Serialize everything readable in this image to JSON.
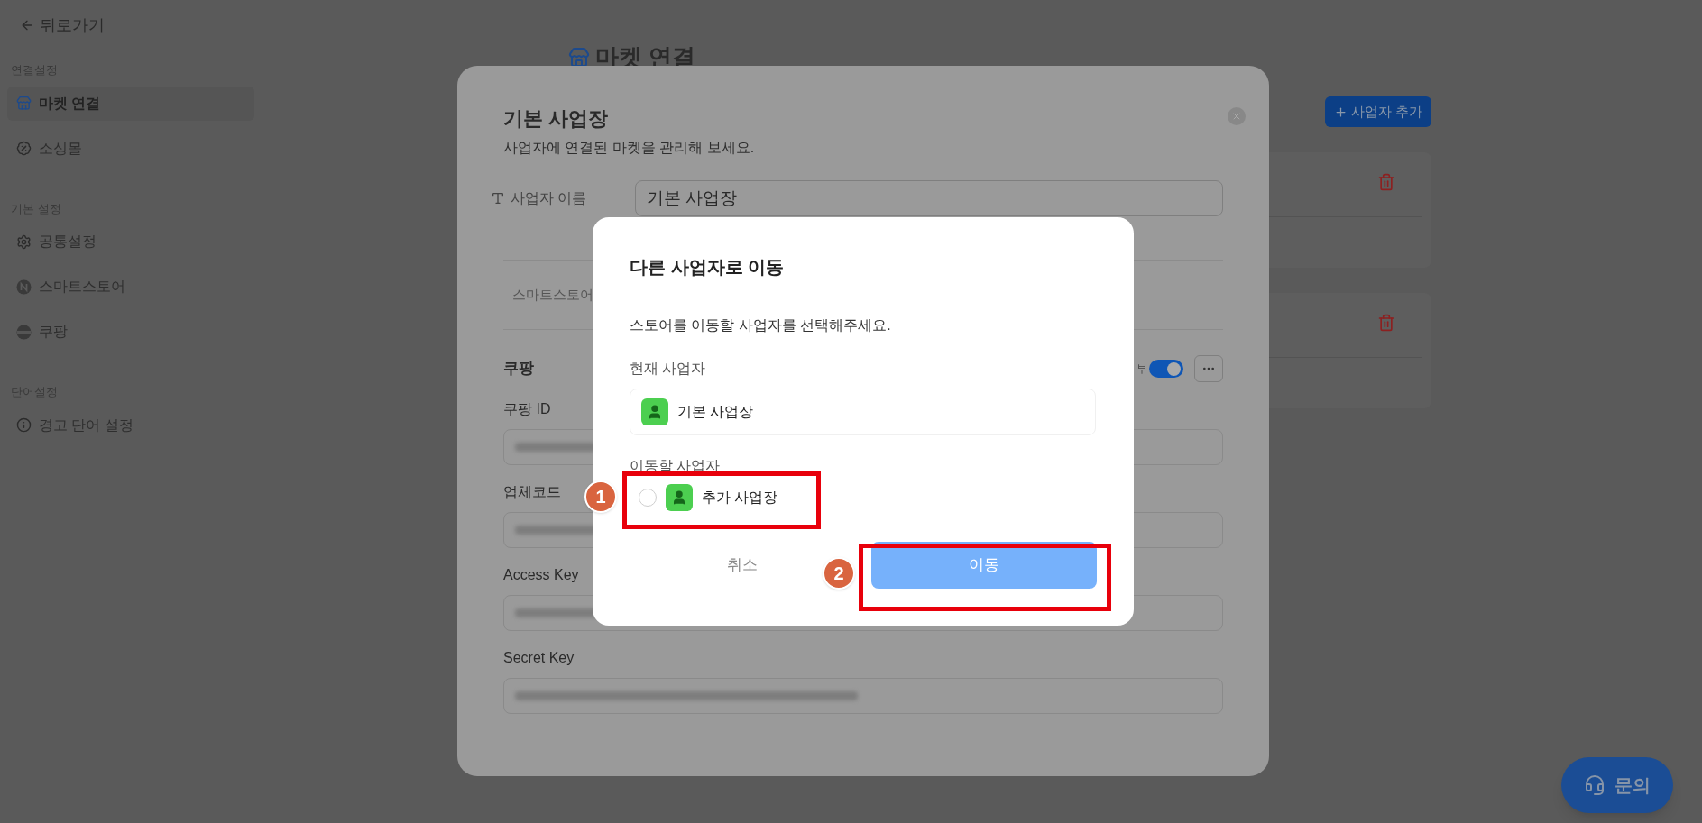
{
  "back_link": "뒤로가기",
  "sidebar": {
    "sections": [
      {
        "label": "연결설정",
        "items": [
          {
            "label": "마켓 연결",
            "selected": true
          },
          {
            "label": "소싱몰",
            "selected": false
          }
        ]
      },
      {
        "label": "기본 설정",
        "items": [
          {
            "label": "공통설정",
            "selected": false
          },
          {
            "label": "스마트스토어",
            "selected": false
          },
          {
            "label": "쿠팡",
            "selected": false
          }
        ]
      },
      {
        "label": "단어설정",
        "items": [
          {
            "label": "경고 단어 설정",
            "selected": false
          }
        ]
      }
    ]
  },
  "page": {
    "title": "마켓 연결",
    "add_button": "사업자 추가"
  },
  "modal": {
    "title": "기본 사업장",
    "subtitle": "사업자에 연결된 마켓을 관리해 보세요.",
    "name_field": {
      "label": "사업자 이름",
      "value": "기본 사업장"
    },
    "tab_label": "스마트스토어",
    "market": {
      "name": "쿠팡",
      "toggle_label": "부",
      "enabled": true,
      "fields": [
        {
          "label": "쿠팡 ID"
        },
        {
          "label": "업체코드"
        },
        {
          "label": "Access Key"
        },
        {
          "label": "Secret Key"
        }
      ]
    }
  },
  "dialog": {
    "title": "다른 사업자로 이동",
    "description": "스토어를 이동할 사업자를 선택해주세요.",
    "current_label": "현재 사업자",
    "current_name": "기본 사업장",
    "target_label": "이동할 사업자",
    "targets": [
      {
        "name": "추가 사업장",
        "selected": false
      }
    ],
    "cancel": "취소",
    "confirm": "이동"
  },
  "annotations": [
    {
      "number": "1"
    },
    {
      "number": "2"
    }
  ],
  "help_button": "문의"
}
